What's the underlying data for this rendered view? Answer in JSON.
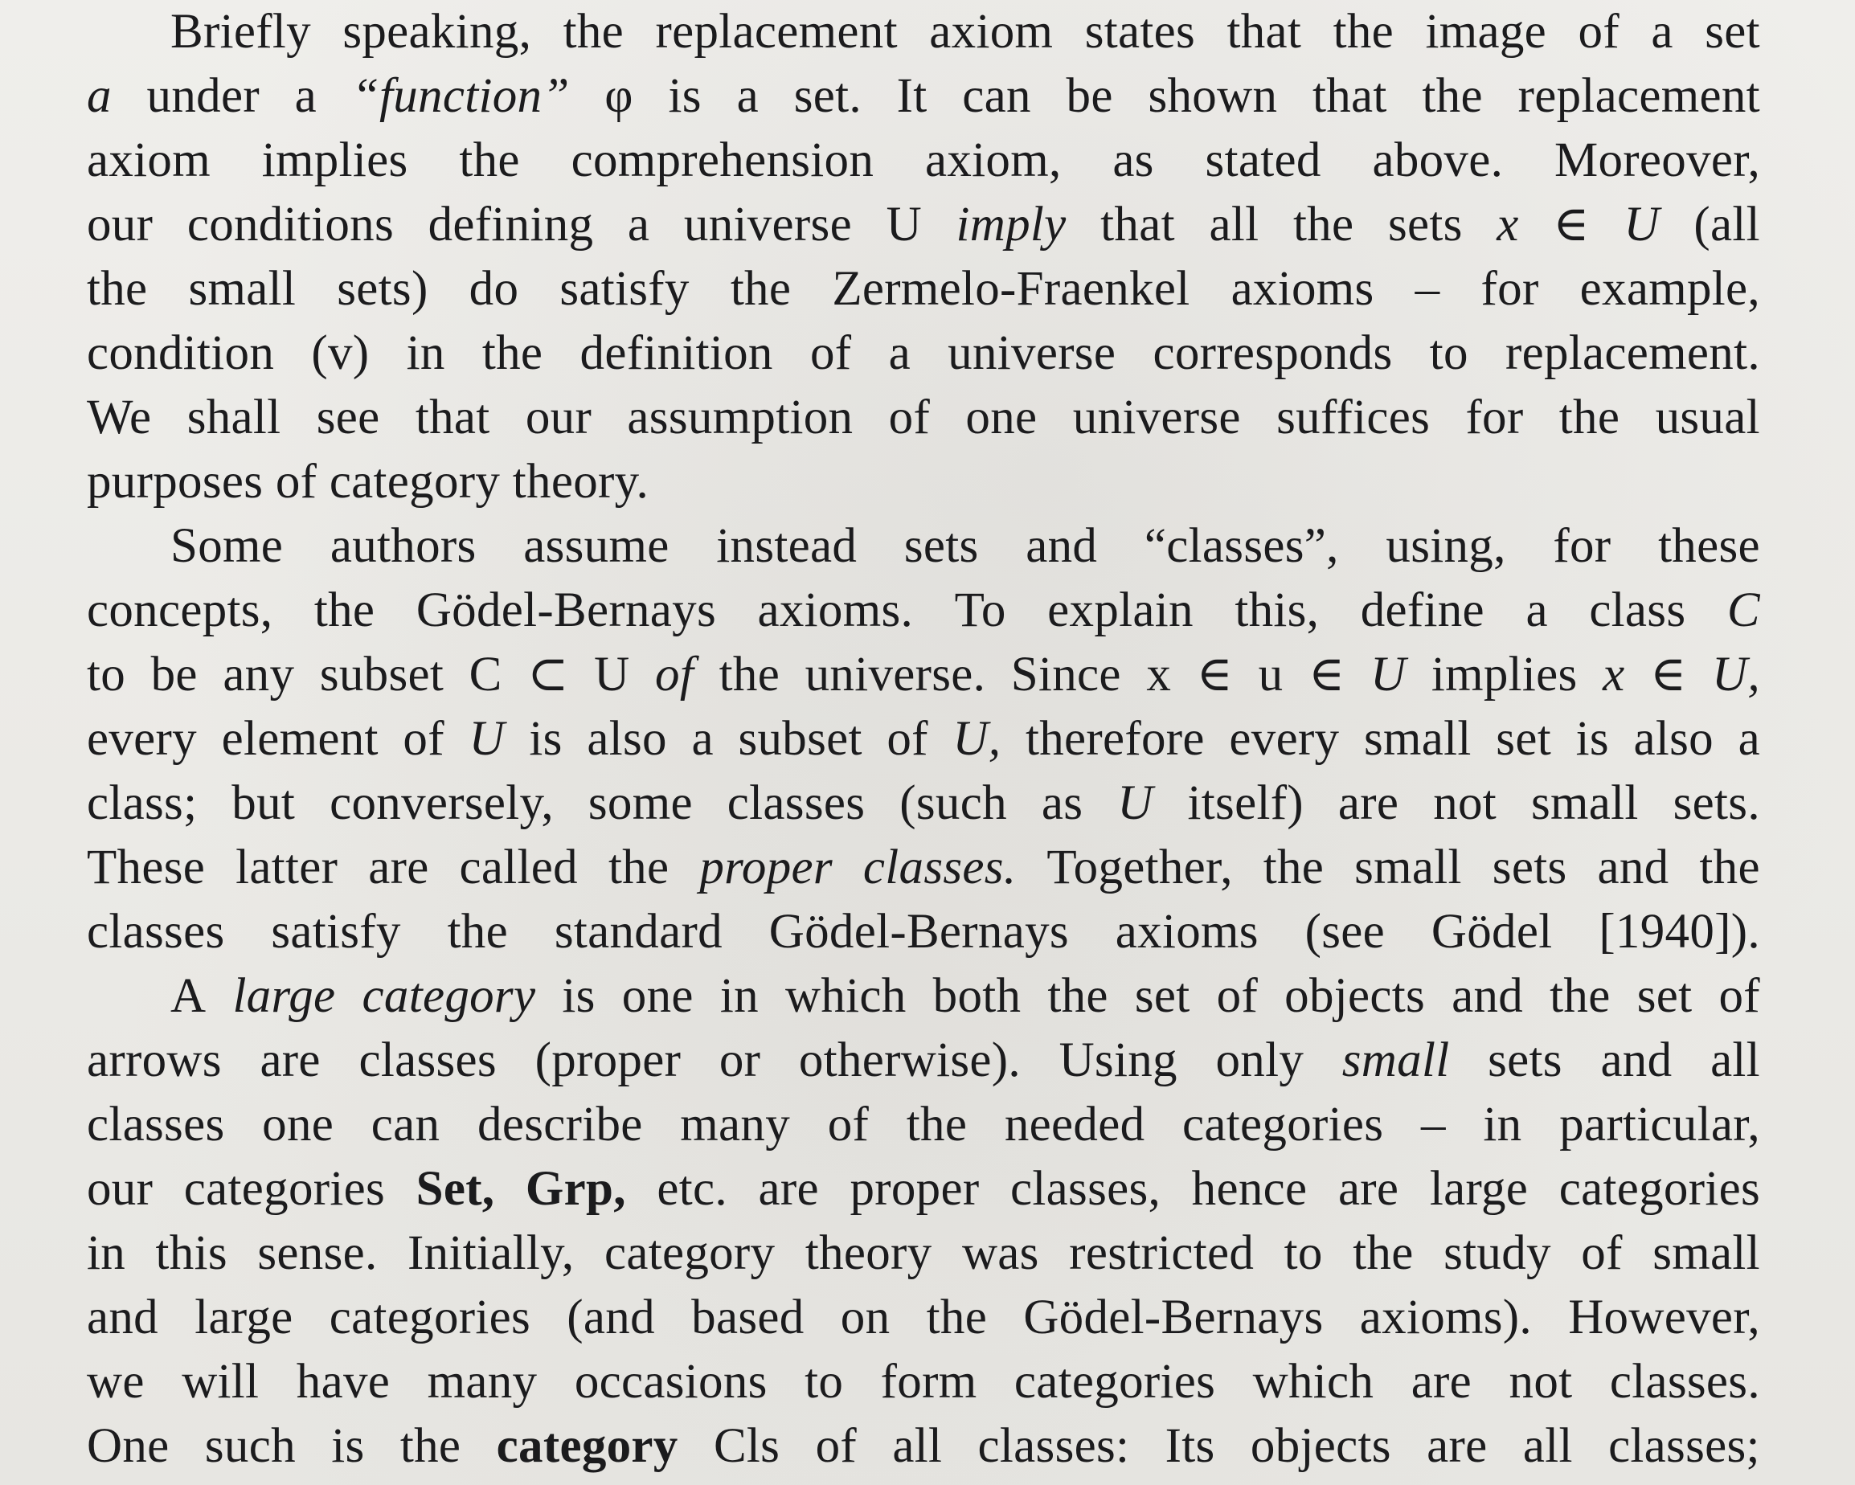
{
  "paragraphs": [
    {
      "lines": [
        "Briefly speaking, the replacement axiom states that the image of a set",
        "a under a “function” φ is a set. It can be shown that the replacement",
        "axiom implies the comprehension axiom, as stated above. Moreover,",
        "our conditions defining a universe U imply that all the sets x ∈ U (all",
        "the small sets) do satisfy the Zermelo-Fraenkel axioms – for example,",
        "condition (v) in the definition of a universe corresponds to replacement.",
        "We shall see that our assumption of one universe suffices for the usual",
        "purposes of category theory."
      ]
    },
    {
      "lines": [
        "Some authors assume instead sets and “classes”, using, for these",
        "concepts, the Gödel-Bernays axioms. To explain this, define a class C",
        "to be any subset C ⊂ U of the universe. Since x ∈ u ∈ U implies x ∈ U,",
        "every element of U is also a subset of U, therefore every small set is also a",
        "class; but conversely, some classes (such as U itself) are not small sets.",
        "These latter are called the proper classes. Together, the small sets and the",
        "classes satisfy the standard Gödel-Bernays axioms (see Gödel [1940])."
      ]
    },
    {
      "lines": [
        "A large category is one in which both the set of objects and the set of",
        "arrows are classes (proper or otherwise). Using only small sets and all",
        "classes one can describe many of the needed categories – in particular,",
        "our categories Set, Grp, etc. are proper classes, hence are large categories",
        "in this sense. Initially, category theory was restricted to the study of small",
        "and large categories (and based on the Gödel-Bernays axioms). However,",
        "we will have many occasions to form categories which are not classes.",
        "One such is the category Cls of all classes: Its objects are all classes;"
      ]
    }
  ]
}
